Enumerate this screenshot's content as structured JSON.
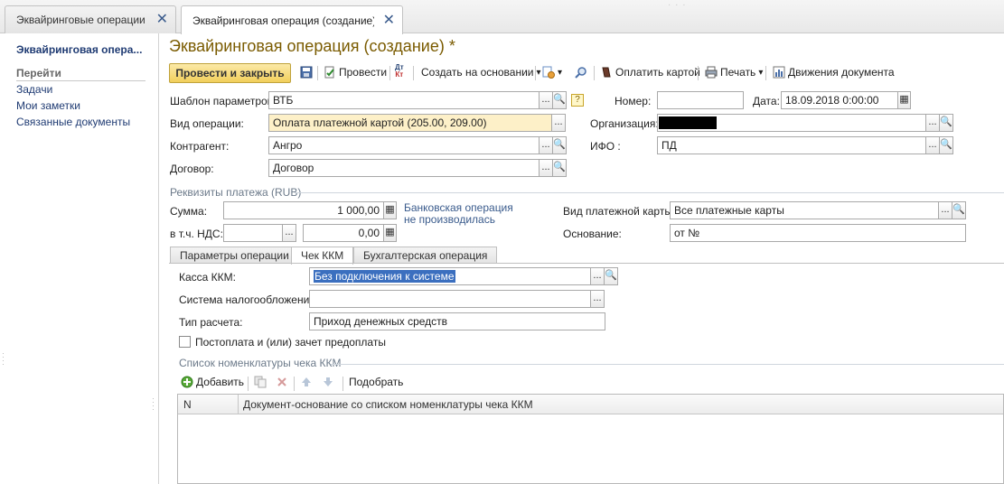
{
  "window_tabs": [
    {
      "label": "Эквайринговые операции",
      "close": "✕"
    },
    {
      "label": "Эквайринговая операция (создание) *",
      "close": "✕"
    }
  ],
  "left_panel": {
    "title": "Эквайринговая опера...",
    "section": "Перейти",
    "links": [
      "Задачи",
      "Мои заметки",
      "Связанные документы"
    ]
  },
  "form": {
    "title": "Эквайринговая операция (создание) *"
  },
  "toolbar": {
    "post_close": "Провести и закрыть",
    "post": "Провести",
    "create_based_on": "Создать на основании",
    "pay_card": "Оплатить картой",
    "print": "Печать",
    "movements": "Движения документа",
    "dt_kt_top": "Дт",
    "dt_kt_bottom": "Кт",
    "dropdown": "▾"
  },
  "fields": {
    "template": {
      "label": "Шаблон параметров:",
      "value": "ВТБ"
    },
    "number": {
      "label": "Номер:",
      "value": ""
    },
    "date": {
      "label": "Дата:",
      "value": "18.09.2018  0:00:00"
    },
    "operation_type": {
      "label": "Вид операции:",
      "value": "Оплата платежной картой (205.00, 209.00)"
    },
    "organization": {
      "label": "Организация:",
      "value": ""
    },
    "counterparty": {
      "label": "Контрагент:",
      "value": "Ангро"
    },
    "ifo": {
      "label": "ИФО :",
      "value": "ПД"
    },
    "contract": {
      "label": "Договор:",
      "value": "Договор"
    }
  },
  "payment": {
    "group_title": "Реквизиты платежа (RUB)",
    "sum_label": "Сумма:",
    "sum_value": "1 000,00",
    "vat_label": "в т.ч. НДС:",
    "vat_rate": "",
    "vat_value": "0,00",
    "bank_note_line1": "Банковская операция",
    "bank_note_line2": "не производилась",
    "card_type_label": "Вид платежной карты:",
    "card_type_value": "Все платежные карты",
    "basis_label": "Основание:",
    "basis_value": "от  №"
  },
  "inner_tabs": [
    "Параметры операции",
    "Чек ККМ",
    "Бухгалтерская операция"
  ],
  "kkm": {
    "register_label": "Касса ККМ:",
    "register_value": "Без подключения к системе",
    "tax_label": "Система налогообложения:",
    "tax_value": "",
    "calc_label": "Тип расчета:",
    "calc_value": "Приход денежных средств",
    "postpay_label": "Постоплата и (или) зачет предоплаты",
    "list_title": "Список номенклатуры чека ККМ"
  },
  "table": {
    "add": "Добавить",
    "select": "Подобрать",
    "columns": [
      "N",
      "Документ-основание со списком номенклатуры чека ККМ"
    ]
  },
  "icons": {
    "ellipsis": "...",
    "question": "?"
  },
  "colors": {
    "title": "#7a5b00",
    "link": "#1f3b73",
    "accent_button": "#f2cf5b",
    "highlight_field": "#fdf0c8",
    "selection": "#3b6fbf"
  }
}
